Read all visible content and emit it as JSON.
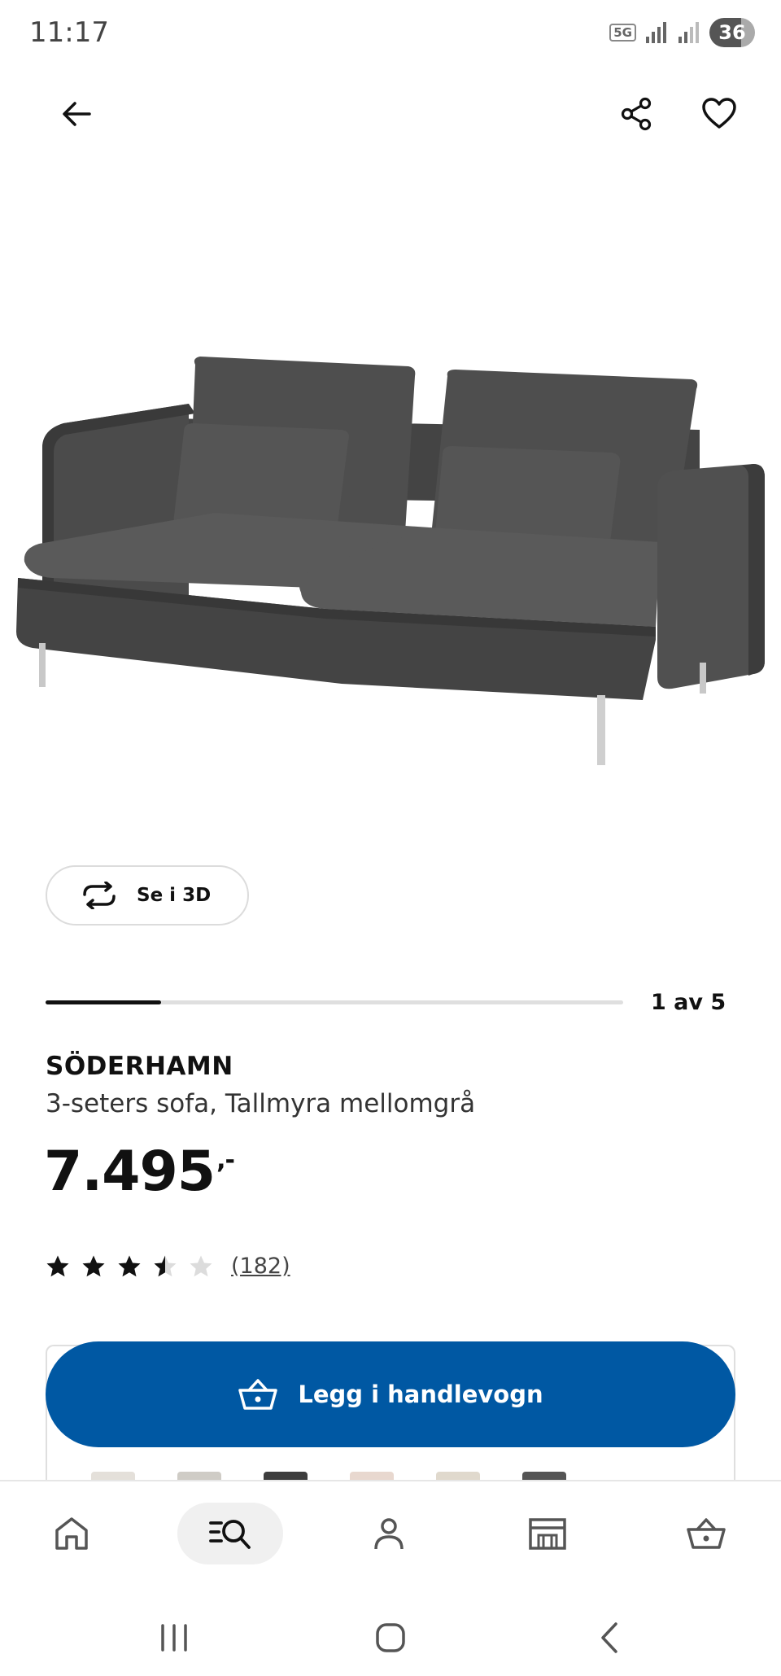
{
  "status_bar": {
    "time": "11:17",
    "network": "5G",
    "battery": "36"
  },
  "icons": {
    "back": "arrow-left",
    "share": "share",
    "favourite": "heart",
    "view3d": "rotate-arrows",
    "cart": "basket"
  },
  "product": {
    "name": "SÖDERHAMN",
    "description": "3-seters sofa, Tallmyra mellomgrå",
    "price": "7.495",
    "price_suffix": ",-",
    "rating_value": 3.5,
    "rating_max": 5,
    "review_count": "(182)"
  },
  "gallery": {
    "view3d_label": "Se i 3D",
    "counter": "1 av 5",
    "progress": 0.2
  },
  "cart": {
    "button_label": "Legg i handlevogn"
  },
  "bottom_nav": [
    {
      "name": "home-icon"
    },
    {
      "name": "search-icon"
    },
    {
      "name": "profile-icon"
    },
    {
      "name": "store-icon"
    },
    {
      "name": "basket-icon"
    }
  ],
  "colors": {
    "primary": "#0058a3",
    "text": "#111111",
    "sofa": "#4a4a4a"
  }
}
